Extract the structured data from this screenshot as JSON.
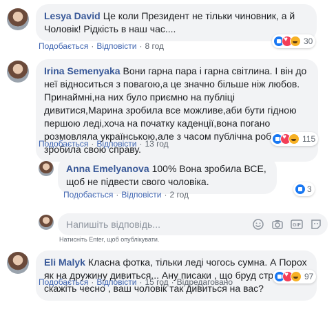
{
  "comments": [
    {
      "author": "Lesya David",
      "text": "Це коли Президент не тільки чиновник, а й Чоловік! Рідкість в наш час....",
      "like": "Подобається",
      "reply": "Відповісти",
      "time": "8 год",
      "reactions": [
        "like",
        "love",
        "haha"
      ],
      "reaction_count": "30"
    },
    {
      "author": "Irina Semenyaka",
      "text": "Вони гарна пара і гарна світлина. І він до неї відноситься з повагою,а це значно більше ніж любов. Принаймні,на них було приємно на публіці дивитися,Марина зробила все можливе,аби бути гідною першою леді,хоча на початку каденції,вона погано розмовляла українською,але з часом публічна робота зробила свою справу.",
      "like": "Подобається",
      "reply": "Відповісти",
      "time": "13 год",
      "reactions": [
        "like",
        "love",
        "haha"
      ],
      "reaction_count": "115"
    },
    {
      "author": "Anna Emelyanova",
      "text": "100% Вона зробила ВСЕ, щоб не підвести свого чоловіка.",
      "like": "Подобається",
      "reply": "Відповісти",
      "time": "2 год",
      "reactions": [
        "like"
      ],
      "reaction_count": "3"
    },
    {
      "author": "Eli Malyk",
      "text": "Класна фотка, тільки леді чогось сумна. А Порох як на дружину дивиться... Ану писаки , що бруд строчать, скажіть чесно , ваш чоловік так дивиться на вас?",
      "like": "Подобається",
      "reply": "Відповісти",
      "time": "15 год",
      "edited": "Відредаговано",
      "reactions": [
        "like",
        "love",
        "haha"
      ],
      "reaction_count": "97"
    }
  ],
  "reply_box": {
    "placeholder": "Напишіть відповідь...",
    "hint": "Натисніть Enter, щоб опублікувати."
  }
}
